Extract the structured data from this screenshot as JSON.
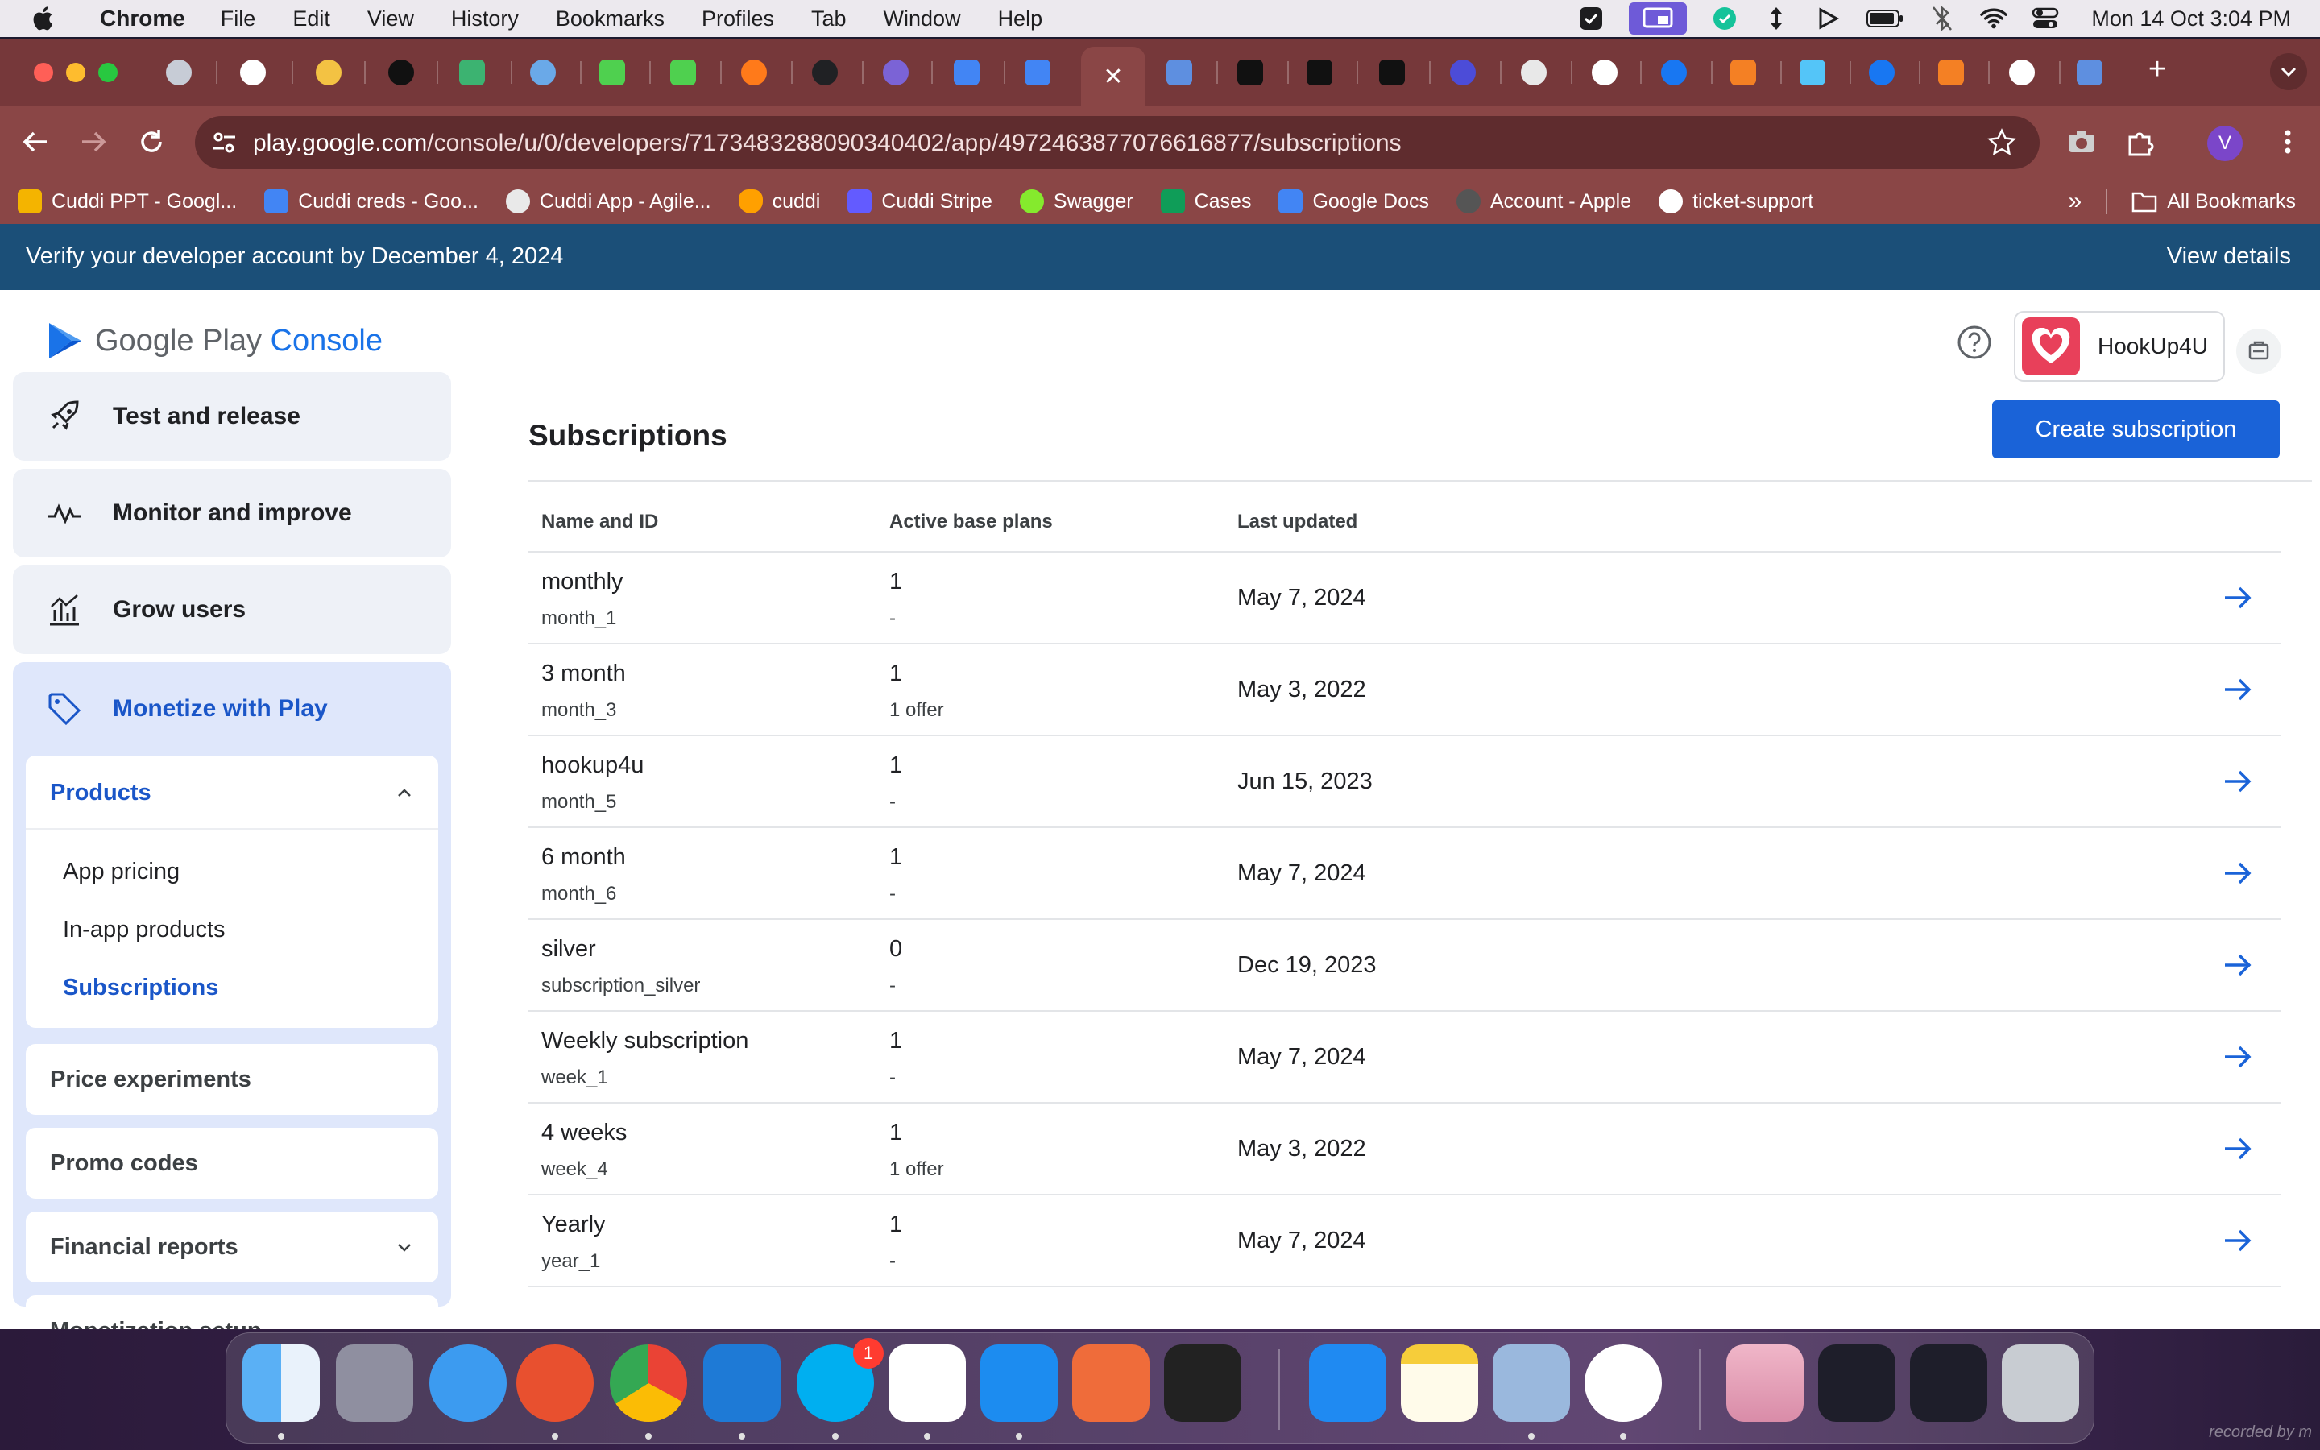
{
  "menubar": {
    "app_name": "Chrome",
    "items": [
      "File",
      "Edit",
      "View",
      "History",
      "Bookmarks",
      "Profiles",
      "Tab",
      "Window",
      "Help"
    ],
    "clock": "Mon 14 Oct  3:04 PM"
  },
  "browser": {
    "url_host": "play.google.com",
    "url_path": "/console/u/0/developers/7173483288090340402/app/4972463877076616877/subscriptions",
    "profile_initial": "V",
    "bookmarks": [
      "Cuddi PPT - Googl...",
      "Cuddi creds - Goo...",
      "Cuddi App - Agile...",
      "cuddi",
      "Cuddi Stripe",
      "Swagger",
      "Cases",
      "Google Docs",
      "Account - Apple",
      "ticket-support"
    ],
    "all_bookmarks": "All Bookmarks"
  },
  "banner": {
    "message": "Verify your developer account by December 4, 2024",
    "link": "View details"
  },
  "header": {
    "logo_text": "Google Play",
    "logo_console": "Console",
    "app_name": "HookUp4U"
  },
  "sidebar": {
    "test_release": "Test and release",
    "monitor": "Monitor and improve",
    "grow": "Grow users",
    "monetize": "Monetize with Play",
    "products": "Products",
    "product_items": [
      "App pricing",
      "In-app products",
      "Subscriptions"
    ],
    "price_experiments": "Price experiments",
    "promo_codes": "Promo codes",
    "financial_reports": "Financial reports",
    "monetization_setup": "Monetization setup"
  },
  "main": {
    "title": "Subscriptions",
    "create_button": "Create subscription",
    "columns": [
      "Name and ID",
      "Active base plans",
      "Last updated"
    ],
    "rows": [
      {
        "name": "monthly",
        "id": "month_1",
        "plans": "1",
        "offer": "-",
        "updated": "May 7, 2024"
      },
      {
        "name": "3 month",
        "id": "month_3",
        "plans": "1",
        "offer": "1 offer",
        "updated": "May 3, 2022"
      },
      {
        "name": "hookup4u",
        "id": "month_5",
        "plans": "1",
        "offer": "-",
        "updated": "Jun 15, 2023"
      },
      {
        "name": "6 month",
        "id": "month_6",
        "plans": "1",
        "offer": "-",
        "updated": "May 7, 2024"
      },
      {
        "name": "silver",
        "id": "subscription_silver",
        "plans": "0",
        "offer": "-",
        "updated": "Dec 19, 2023"
      },
      {
        "name": "Weekly subscription",
        "id": "week_1",
        "plans": "1",
        "offer": "-",
        "updated": "May 7, 2024"
      },
      {
        "name": "4 weeks",
        "id": "week_4",
        "plans": "1",
        "offer": "1 offer",
        "updated": "May 3, 2022"
      },
      {
        "name": "Yearly",
        "id": "year_1",
        "plans": "1",
        "offer": "-",
        "updated": "May 7, 2024"
      }
    ]
  },
  "dock": {
    "skype_badge": "1",
    "watermark": "recorded by m"
  },
  "colors": {
    "accent": "#1a63d8",
    "banner": "#1b4f78",
    "chrome_frame": "#8a4646"
  }
}
